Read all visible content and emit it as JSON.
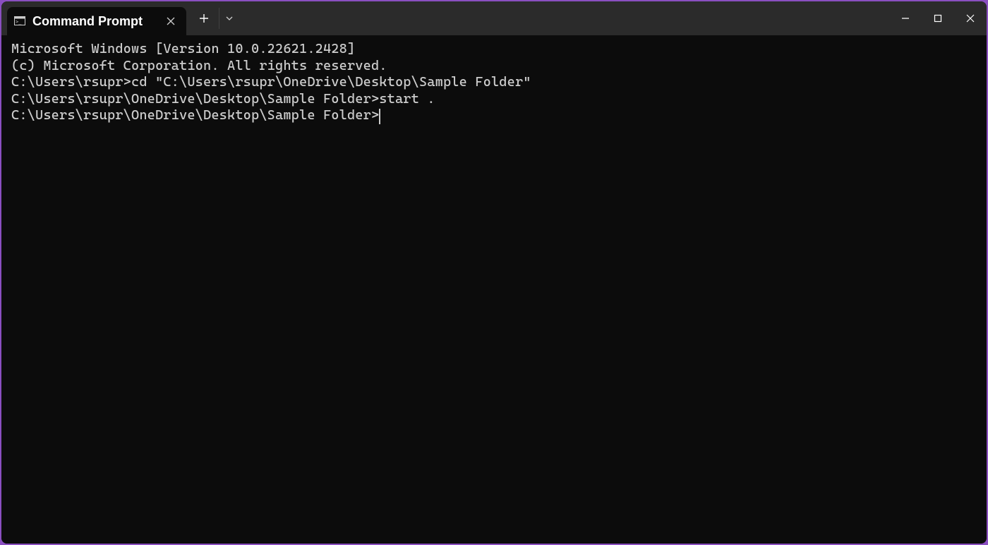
{
  "tab": {
    "title": "Command Prompt"
  },
  "terminal": {
    "lines": [
      "Microsoft Windows [Version 10.0.22621.2428]",
      "(c) Microsoft Corporation. All rights reserved.",
      "",
      "C:\\Users\\rsupr>cd \"C:\\Users\\rsupr\\OneDrive\\Desktop\\Sample Folder\"",
      "",
      "C:\\Users\\rsupr\\OneDrive\\Desktop\\Sample Folder>start .",
      "",
      "C:\\Users\\rsupr\\OneDrive\\Desktop\\Sample Folder>"
    ]
  }
}
